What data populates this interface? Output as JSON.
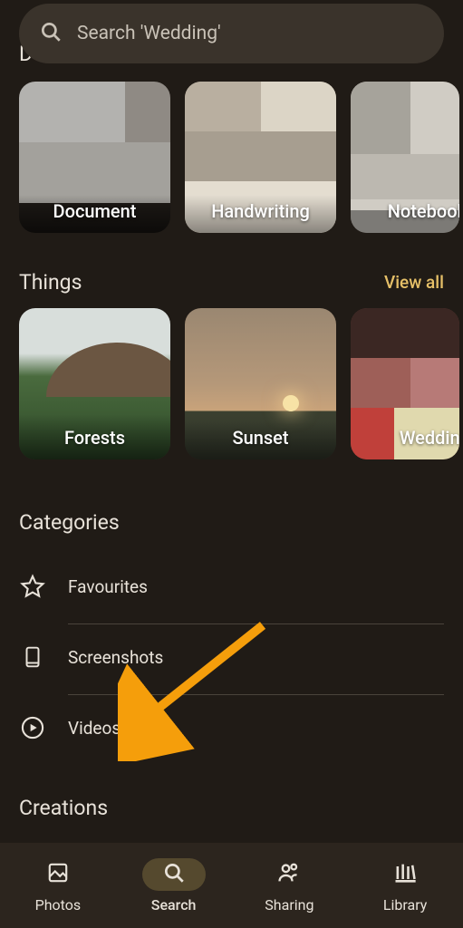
{
  "search": {
    "placeholder": "Search 'Wedding'"
  },
  "documents": {
    "partial_section_letter": "D",
    "items": [
      {
        "label": "Document"
      },
      {
        "label": "Handwriting"
      },
      {
        "label": "Notebook"
      }
    ]
  },
  "things": {
    "title": "Things",
    "view_all": "View all",
    "items": [
      {
        "label": "Forests"
      },
      {
        "label": "Sunset"
      },
      {
        "label": "Wedding"
      }
    ]
  },
  "categories": {
    "title": "Categories",
    "items": [
      {
        "icon": "star",
        "label": "Favourites"
      },
      {
        "icon": "screenshot",
        "label": "Screenshots"
      },
      {
        "icon": "play-circle",
        "label": "Videos"
      }
    ]
  },
  "creations": {
    "title": "Creations"
  },
  "nav": {
    "items": [
      {
        "icon": "photos",
        "label": "Photos",
        "active": false
      },
      {
        "icon": "search",
        "label": "Search",
        "active": true
      },
      {
        "icon": "sharing",
        "label": "Sharing",
        "active": false
      },
      {
        "icon": "library",
        "label": "Library",
        "active": false
      }
    ]
  },
  "colors": {
    "accent": "#e6c068",
    "bg": "#201b16",
    "surface": "#3a332b",
    "nav": "#2c251e"
  }
}
